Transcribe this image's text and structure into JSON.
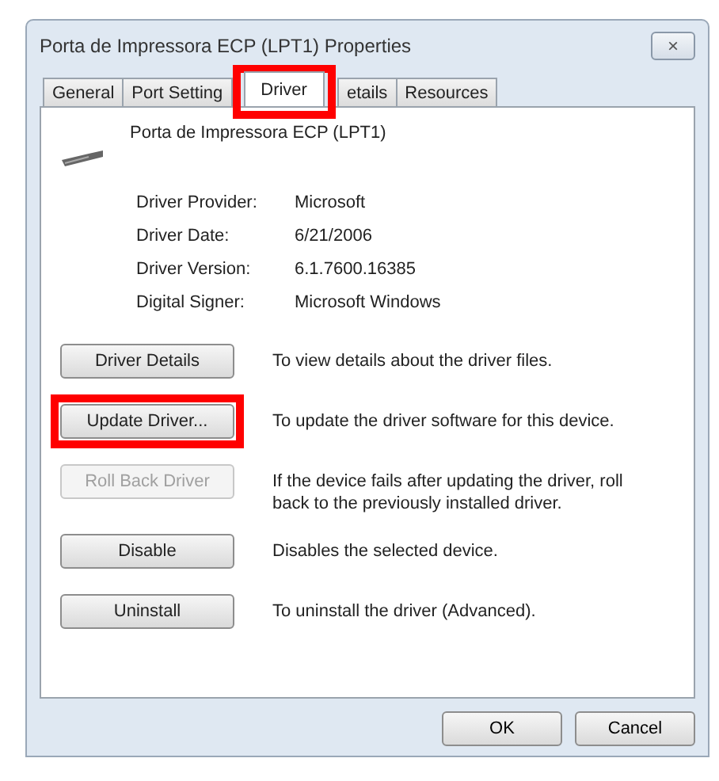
{
  "window": {
    "title": "Porta de Impressora ECP (LPT1) Properties",
    "close": "×"
  },
  "tabs": [
    {
      "label": "General",
      "selected": false,
      "highlighted": false
    },
    {
      "label": "Port Setting",
      "selected": false,
      "highlighted": false
    },
    {
      "label": "Driver",
      "selected": true,
      "highlighted": true
    },
    {
      "label": "etails",
      "selected": false,
      "highlighted": false
    },
    {
      "label": "Resources",
      "selected": false,
      "highlighted": false
    }
  ],
  "device": {
    "name": "Porta de Impressora ECP (LPT1)"
  },
  "properties": [
    {
      "label": "Driver Provider:",
      "value": "Microsoft"
    },
    {
      "label": "Driver Date:",
      "value": "6/21/2006"
    },
    {
      "label": "Driver Version:",
      "value": "6.1.7600.16385"
    },
    {
      "label": "Digital Signer:",
      "value": "Microsoft Windows"
    }
  ],
  "actions": [
    {
      "button": "Driver Details",
      "description": "To view details about the driver files.",
      "disabled": false,
      "highlighted": false
    },
    {
      "button": "Update Driver...",
      "description": "To update the driver software for this device.",
      "disabled": false,
      "highlighted": true
    },
    {
      "button": "Roll Back Driver",
      "description": "If the device fails after updating the driver, roll back to the previously installed driver.",
      "disabled": true,
      "highlighted": false
    },
    {
      "button": "Disable",
      "description": "Disables the selected device.",
      "disabled": false,
      "highlighted": false
    },
    {
      "button": "Uninstall",
      "description": "To uninstall the driver (Advanced).",
      "disabled": false,
      "highlighted": false
    }
  ],
  "buttons": [
    "OK",
    "Cancel"
  ]
}
